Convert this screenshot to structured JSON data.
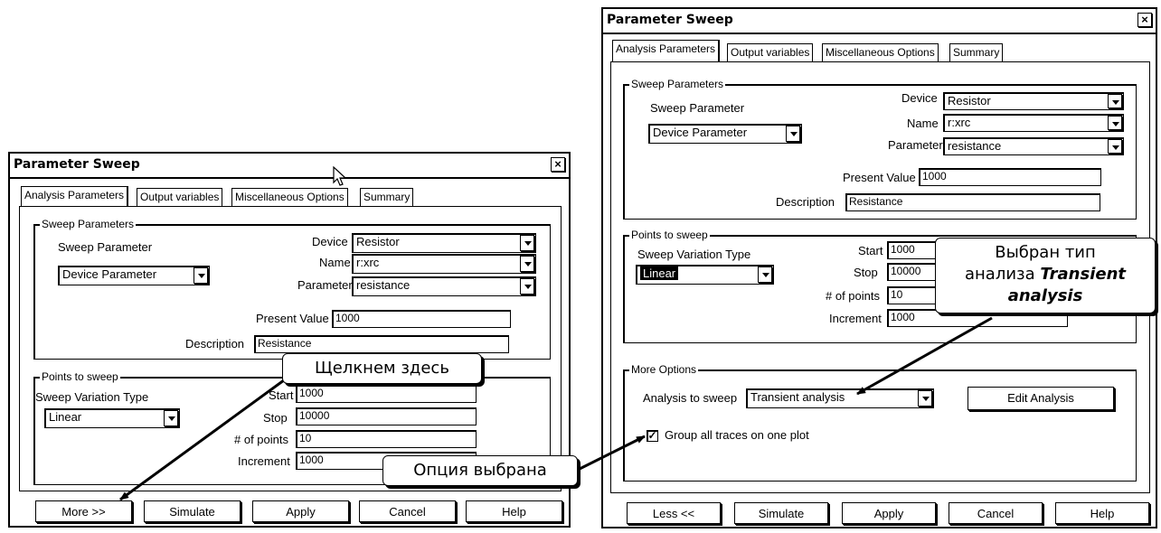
{
  "left": {
    "title": "Parameter Sweep",
    "close": "×",
    "tabs": [
      "Analysis Parameters",
      "Output variables",
      "Miscellaneous Options",
      "Summary"
    ],
    "sweep_group": "Sweep Parameters",
    "sweep_param_label": "Sweep Parameter",
    "sweep_param_value": "Device Parameter",
    "device_label": "Device",
    "device_value": "Resistor",
    "name_label": "Name",
    "name_value": "r:xrc",
    "parameter_label": "Parameter",
    "parameter_value": "resistance",
    "present_label": "Present Value",
    "present_value": "1000",
    "description_label": "Description",
    "description_value": "Resistance",
    "points_group": "Points to sweep",
    "variation_label": "Sweep Variation Type",
    "variation_value": "Linear",
    "start_label": "Start",
    "start_value": "1000",
    "stop_label": "Stop",
    "stop_value": "10000",
    "points_label": "# of points",
    "points_value": "10",
    "increment_label": "Increment",
    "increment_value": "1000",
    "buttons": [
      "More >>",
      "Simulate",
      "Apply",
      "Cancel",
      "Help"
    ]
  },
  "right": {
    "title": "Parameter Sweep",
    "close": "×",
    "tabs": [
      "Analysis Parameters",
      "Output variables",
      "Miscellaneous Options",
      "Summary"
    ],
    "sweep_group": "Sweep Parameters",
    "sweep_param_label": "Sweep Parameter",
    "sweep_param_value": "Device Parameter",
    "device_label": "Device",
    "device_value": "Resistor",
    "name_label": "Name",
    "name_value": "r:xrc",
    "parameter_label": "Parameter",
    "parameter_value": "resistance",
    "present_label": "Present Value",
    "present_value": "1000",
    "description_label": "Description",
    "description_value": "Resistance",
    "points_group": "Points to sweep",
    "variation_label": "Sweep Variation Type",
    "variation_value": "Linear",
    "start_label": "Start",
    "start_value": "1000",
    "stop_label": "Stop",
    "stop_value": "10000",
    "points_label": "# of points",
    "points_value": "10",
    "increment_label": "Increment",
    "increment_value": "1000",
    "more_group": "More Options",
    "analysis_label": "Analysis to sweep",
    "analysis_value": "Transient analysis",
    "edit_analysis": "Edit Analysis",
    "group_traces": "Group all traces on one plot",
    "check_mark": "✓",
    "buttons": [
      "Less <<",
      "Simulate",
      "Apply",
      "Cancel",
      "Help"
    ]
  },
  "callouts": {
    "click_here": "Щелкнем здесь",
    "option_selected": "Опция выбрана",
    "type_line1": "Выбран тип",
    "type_line2_prefix": "анализа ",
    "type_line2_bold": "Transient",
    "type_line3_bold": "analysis"
  },
  "icons": {
    "cursor": "arrow-cursor-icon",
    "close": "close-icon",
    "dropdown": "chevron-down-icon"
  }
}
